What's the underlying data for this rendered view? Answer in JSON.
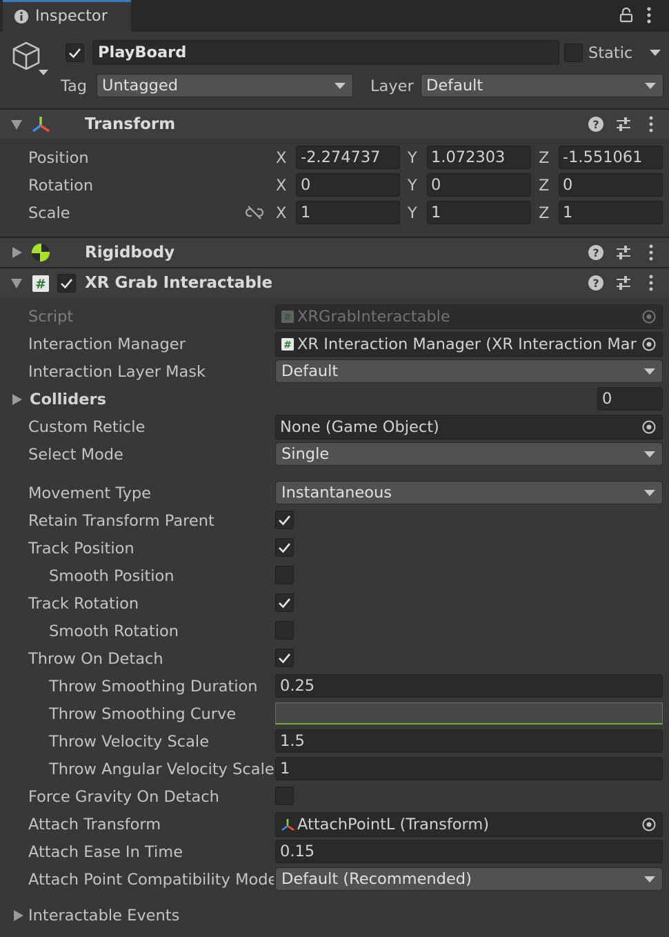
{
  "tab": {
    "title": "Inspector"
  },
  "object": {
    "name": "PlayBoard",
    "active": true,
    "static_label": "Static",
    "tag_label": "Tag",
    "tag_value": "Untagged",
    "layer_label": "Layer",
    "layer_value": "Default"
  },
  "transform": {
    "title": "Transform",
    "rows": [
      {
        "label": "Position",
        "x": "-2.274737",
        "y": "1.072303",
        "z": "-1.551061"
      },
      {
        "label": "Rotation",
        "x": "0",
        "y": "0",
        "z": "0"
      },
      {
        "label": "Scale",
        "x": "1",
        "y": "1",
        "z": "1"
      }
    ],
    "axis": {
      "x": "X",
      "y": "Y",
      "z": "Z"
    }
  },
  "rigidbody": {
    "title": "Rigidbody"
  },
  "xr": {
    "title": "XR Grab Interactable",
    "enabled": true,
    "script_label": "Script",
    "script_value": "XRGrabInteractable",
    "manager_label": "Interaction Manager",
    "manager_value": "XR Interaction Manager (XR Interaction Man",
    "layer_mask_label": "Interaction Layer Mask",
    "layer_mask_value": "Default",
    "colliders_label": "Colliders",
    "colliders_count": "0",
    "reticle_label": "Custom Reticle",
    "reticle_value": "None (Game Object)",
    "select_mode_label": "Select Mode",
    "select_mode_value": "Single",
    "movement_label": "Movement Type",
    "movement_value": "Instantaneous",
    "retain_label": "Retain Transform Parent",
    "retain_checked": true,
    "track_pos_label": "Track Position",
    "track_pos_checked": true,
    "smooth_pos_label": "Smooth Position",
    "smooth_pos_checked": false,
    "track_rot_label": "Track Rotation",
    "track_rot_checked": true,
    "smooth_rot_label": "Smooth Rotation",
    "smooth_rot_checked": false,
    "throw_label": "Throw On Detach",
    "throw_checked": true,
    "throw_dur_label": "Throw Smoothing Duration",
    "throw_dur_value": "0.25",
    "throw_curve_label": "Throw Smoothing Curve",
    "throw_vel_label": "Throw Velocity Scale",
    "throw_vel_value": "1.5",
    "throw_ang_label": "Throw Angular Velocity Scale",
    "throw_ang_value": "1",
    "gravity_label": "Force Gravity On Detach",
    "gravity_checked": false,
    "attach_label": "Attach Transform",
    "attach_value": "AttachPointL (Transform)",
    "ease_label": "Attach Ease In Time",
    "ease_value": "0.15",
    "compat_label": "Attach Point Compatibility Mode",
    "compat_value": "Default (Recommended)",
    "events_label": "Interactable Events"
  },
  "icons": {
    "info": "info-icon",
    "lock": "lock-icon",
    "menu": "kebab-menu-icon",
    "cube": "gameobject-cube-icon",
    "transform": "transform-axes-icon",
    "rigidbody": "rigidbody-icon",
    "script": "csharp-script-icon",
    "help": "help-icon",
    "presets": "presets-sliders-icon",
    "target": "object-picker-icon",
    "unlink": "unlinked-scale-icon"
  },
  "colors": {
    "accent": "#3a79bb",
    "background": "#383838",
    "field": "#2a2a2a",
    "header": "#3e3e3e"
  }
}
